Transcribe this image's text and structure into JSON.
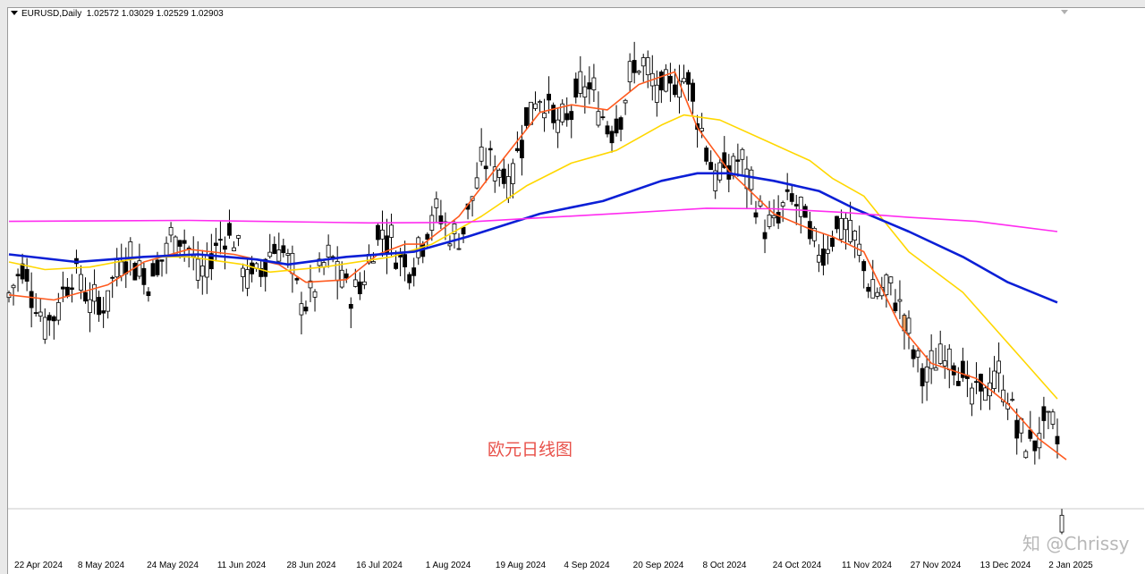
{
  "header": {
    "symbol_label": "EURUSD,Daily",
    "ohlc": "1.02572 1.03029 1.02529 1.02903"
  },
  "annotation": "欧元日线图",
  "watermark": "知 @Chrissy",
  "colors": {
    "ma_fast": "#ff5a1f",
    "ma_mid": "#ffd700",
    "ma_slow": "#0b1fd6",
    "ma_long": "#ff2cf0",
    "bull": "#ffffff",
    "bear": "#000000",
    "highlight": "#f0a060"
  },
  "chart_data": {
    "type": "candlestick",
    "symbol": "EURUSD",
    "timeframe": "Daily",
    "x_tick_labels": [
      "22 Apr 2024",
      "8 May 2024",
      "24 May 2024",
      "11 Jun 2024",
      "28 Jun 2024",
      "16 Jul 2024",
      "1 Aug 2024",
      "19 Aug 2024",
      "4 Sep 2024",
      "20 Sep 2024",
      "8 Oct 2024",
      "24 Oct 2024",
      "11 Nov 2024",
      "27 Nov 2024",
      "13 Dec 2024",
      "2 Jan 2025"
    ],
    "ylim": [
      1.0245,
      1.1245
    ],
    "last_candle": {
      "open": 1.02572,
      "high": 1.03029,
      "low": 1.02529,
      "close": 1.02903
    },
    "series": [
      {
        "name": "",
        "color": "#ff5a1f",
        "points": [
          [
            0,
            1.0725
          ],
          [
            10,
            1.0715
          ],
          [
            22,
            1.0745
          ],
          [
            30,
            1.079
          ],
          [
            40,
            1.0815
          ],
          [
            50,
            1.0805
          ],
          [
            60,
            1.0785
          ],
          [
            66,
            1.075
          ],
          [
            75,
            1.0755
          ],
          [
            82,
            1.0805
          ],
          [
            88,
            1.0825
          ],
          [
            92,
            1.0825
          ],
          [
            100,
            1.088
          ],
          [
            110,
            1.0995
          ],
          [
            118,
            1.1085
          ],
          [
            125,
            1.11
          ],
          [
            133,
            1.109
          ],
          [
            140,
            1.114
          ],
          [
            148,
            1.1165
          ],
          [
            153,
            1.1055
          ],
          [
            160,
            1.097
          ],
          [
            170,
            1.0885
          ],
          [
            178,
            1.0855
          ],
          [
            183,
            1.084
          ],
          [
            190,
            1.081
          ],
          [
            198,
            1.0665
          ],
          [
            205,
            1.059
          ],
          [
            215,
            1.056
          ],
          [
            222,
            1.051
          ],
          [
            229,
            1.044
          ],
          [
            235,
            1.04
          ]
        ]
      },
      {
        "name": "",
        "color": "#ffd700",
        "points": [
          [
            0,
            1.079
          ],
          [
            8,
            1.0775
          ],
          [
            18,
            1.078
          ],
          [
            30,
            1.08
          ],
          [
            40,
            1.08
          ],
          [
            52,
            1.0785
          ],
          [
            58,
            1.077
          ],
          [
            70,
            1.078
          ],
          [
            85,
            1.08
          ],
          [
            94,
            1.0825
          ],
          [
            105,
            1.088
          ],
          [
            115,
            1.094
          ],
          [
            125,
            1.0985
          ],
          [
            135,
            1.101
          ],
          [
            145,
            1.106
          ],
          [
            150,
            1.108
          ],
          [
            158,
            1.107
          ],
          [
            168,
            1.103
          ],
          [
            178,
            1.099
          ],
          [
            183,
            1.0955
          ],
          [
            190,
            1.092
          ],
          [
            200,
            1.081
          ],
          [
            212,
            1.073
          ],
          [
            222,
            1.063
          ],
          [
            233,
            1.052
          ]
        ]
      },
      {
        "name": "",
        "color": "#0b1fd6",
        "points": [
          [
            0,
            1.0805
          ],
          [
            15,
            1.079
          ],
          [
            30,
            1.08
          ],
          [
            42,
            1.0805
          ],
          [
            55,
            1.0795
          ],
          [
            62,
            1.0785
          ],
          [
            75,
            1.08
          ],
          [
            90,
            1.081
          ],
          [
            102,
            1.084
          ],
          [
            118,
            1.0885
          ],
          [
            132,
            1.091
          ],
          [
            145,
            1.095
          ],
          [
            153,
            1.0965
          ],
          [
            160,
            1.0965
          ],
          [
            170,
            1.095
          ],
          [
            180,
            1.093
          ],
          [
            188,
            1.0895
          ],
          [
            200,
            1.085
          ],
          [
            212,
            1.08
          ],
          [
            222,
            1.075
          ],
          [
            233,
            1.071
          ]
        ]
      },
      {
        "name": "",
        "color": "#ff2cf0",
        "points": [
          [
            0,
            1.087
          ],
          [
            40,
            1.0872
          ],
          [
            80,
            1.0867
          ],
          [
            100,
            1.0868
          ],
          [
            120,
            1.0878
          ],
          [
            140,
            1.0888
          ],
          [
            155,
            1.0896
          ],
          [
            170,
            1.0895
          ],
          [
            185,
            1.0888
          ],
          [
            200,
            1.0878
          ],
          [
            215,
            1.087
          ],
          [
            233,
            1.085
          ]
        ]
      }
    ]
  }
}
